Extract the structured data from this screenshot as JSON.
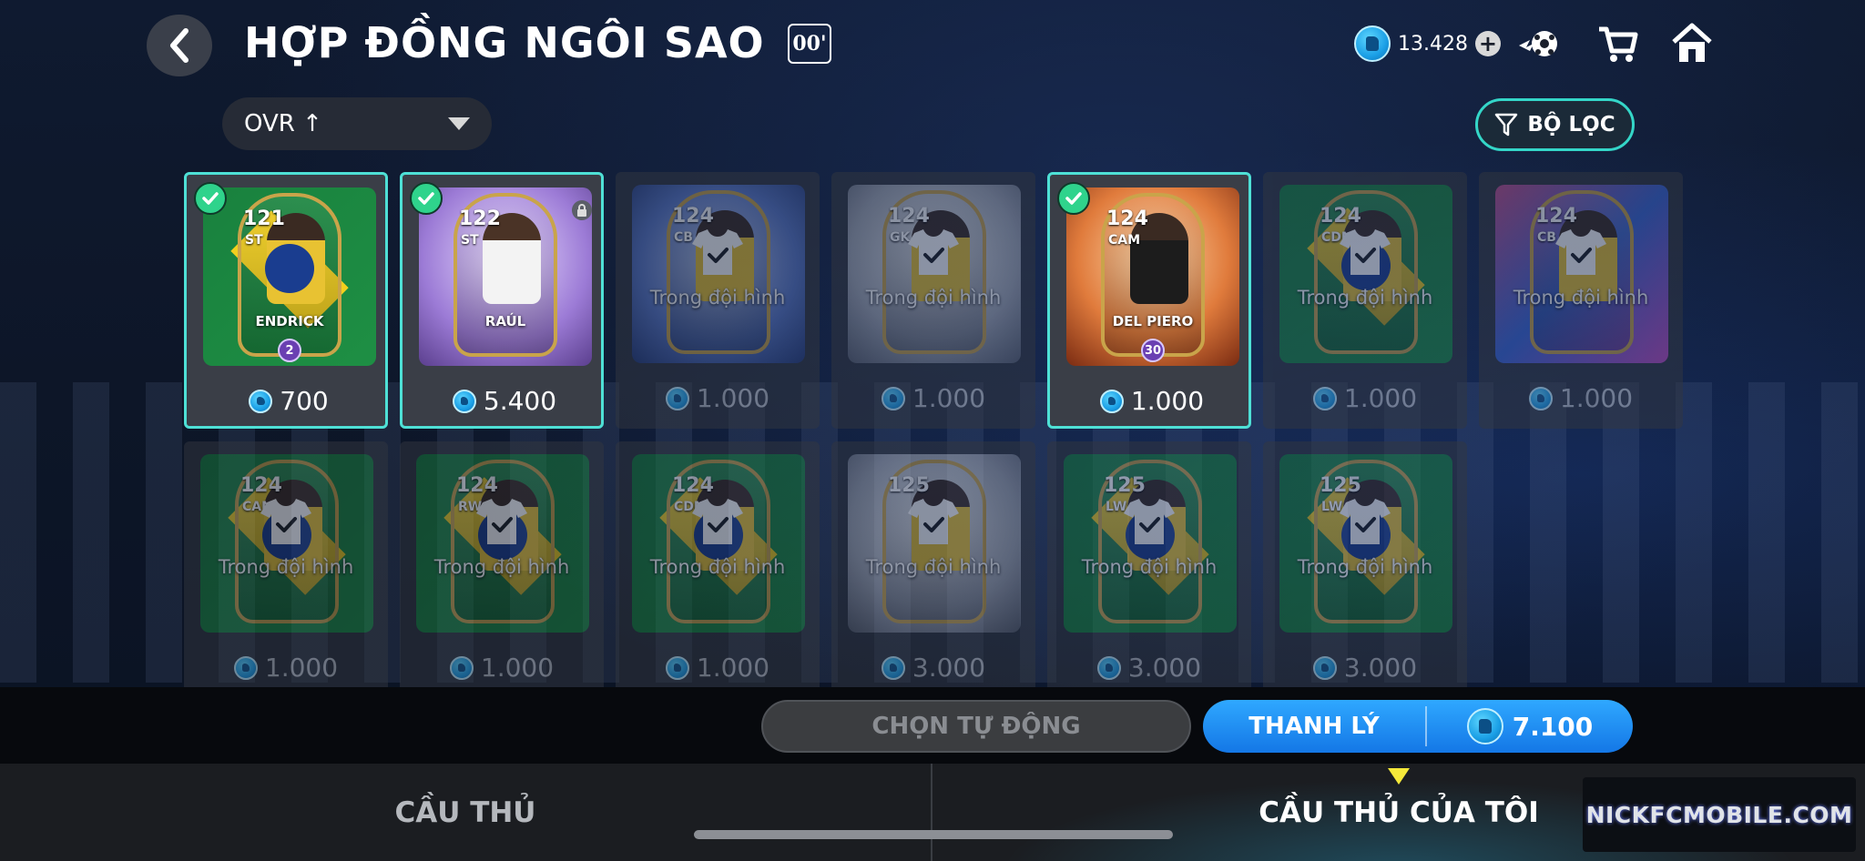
{
  "header": {
    "title": "HỢP ĐỒNG NGÔI SAO",
    "title_badge": "00'",
    "currency_value": "13.428"
  },
  "sort": {
    "label": "OVR ↑"
  },
  "filter": {
    "label": "BỘ LỌC"
  },
  "cards": [
    {
      "ovr": "121",
      "pos": "ST",
      "name": "ENDRICK",
      "level": "2",
      "price": "700",
      "state": "selected",
      "style": "flag"
    },
    {
      "ovr": "122",
      "pos": "ST",
      "name": "RAÚL",
      "price": "5.400",
      "state": "selected",
      "style": "purple",
      "locked": true
    },
    {
      "ovr": "124",
      "pos": "CB",
      "price": "1.000",
      "state": "in_squad",
      "style": "blue",
      "overlay": "Trong đội hình"
    },
    {
      "ovr": "124",
      "pos": "GK",
      "price": "1.000",
      "state": "in_squad",
      "style": "silver",
      "overlay": "Trong đội hình"
    },
    {
      "ovr": "124",
      "pos": "CAM",
      "name": "DEL PIERO",
      "level": "30",
      "price": "1.000",
      "state": "selected",
      "style": "fire"
    },
    {
      "ovr": "124",
      "pos": "CDM",
      "price": "1.000",
      "state": "in_squad",
      "style": "flag",
      "overlay": "Trong đội hình"
    },
    {
      "ovr": "124",
      "pos": "CB",
      "price": "1.000",
      "state": "in_squad",
      "style": "multi",
      "overlay": "Trong đội hình"
    },
    {
      "ovr": "124",
      "pos": "CAM",
      "price": "1.000",
      "state": "in_squad",
      "style": "flag",
      "overlay": "Trong đội hình"
    },
    {
      "ovr": "124",
      "pos": "RW",
      "price": "1.000",
      "state": "in_squad",
      "style": "flag",
      "overlay": "Trong đội hình"
    },
    {
      "ovr": "124",
      "pos": "CDM",
      "price": "1.000",
      "state": "in_squad",
      "style": "flag",
      "overlay": "Trong đội hình"
    },
    {
      "ovr": "125",
      "pos": "",
      "price": "3.000",
      "state": "in_squad",
      "style": "silver",
      "overlay": "Trong đội hình"
    },
    {
      "ovr": "125",
      "pos": "LW",
      "price": "3.000",
      "state": "in_squad",
      "style": "flag",
      "overlay": "Trong đội hình"
    },
    {
      "ovr": "125",
      "pos": "LW",
      "price": "3.000",
      "state": "in_squad",
      "style": "flag",
      "overlay": "Trong đội hình"
    }
  ],
  "actions": {
    "auto_select": "CHỌN TỰ ĐỘNG",
    "sell": "THANH LÝ",
    "sell_total": "7.100"
  },
  "tabs": {
    "players": "CẦU THỦ",
    "my_players": "CẦU THỦ CỦA TÔI"
  },
  "watermark": "NICKFCMOBILE.COM",
  "colors": {
    "accent": "#4ee0d6",
    "sell_button": "#1f8ff0",
    "selected_check": "#2fd38c",
    "tab_indicator": "#f5e93a"
  }
}
